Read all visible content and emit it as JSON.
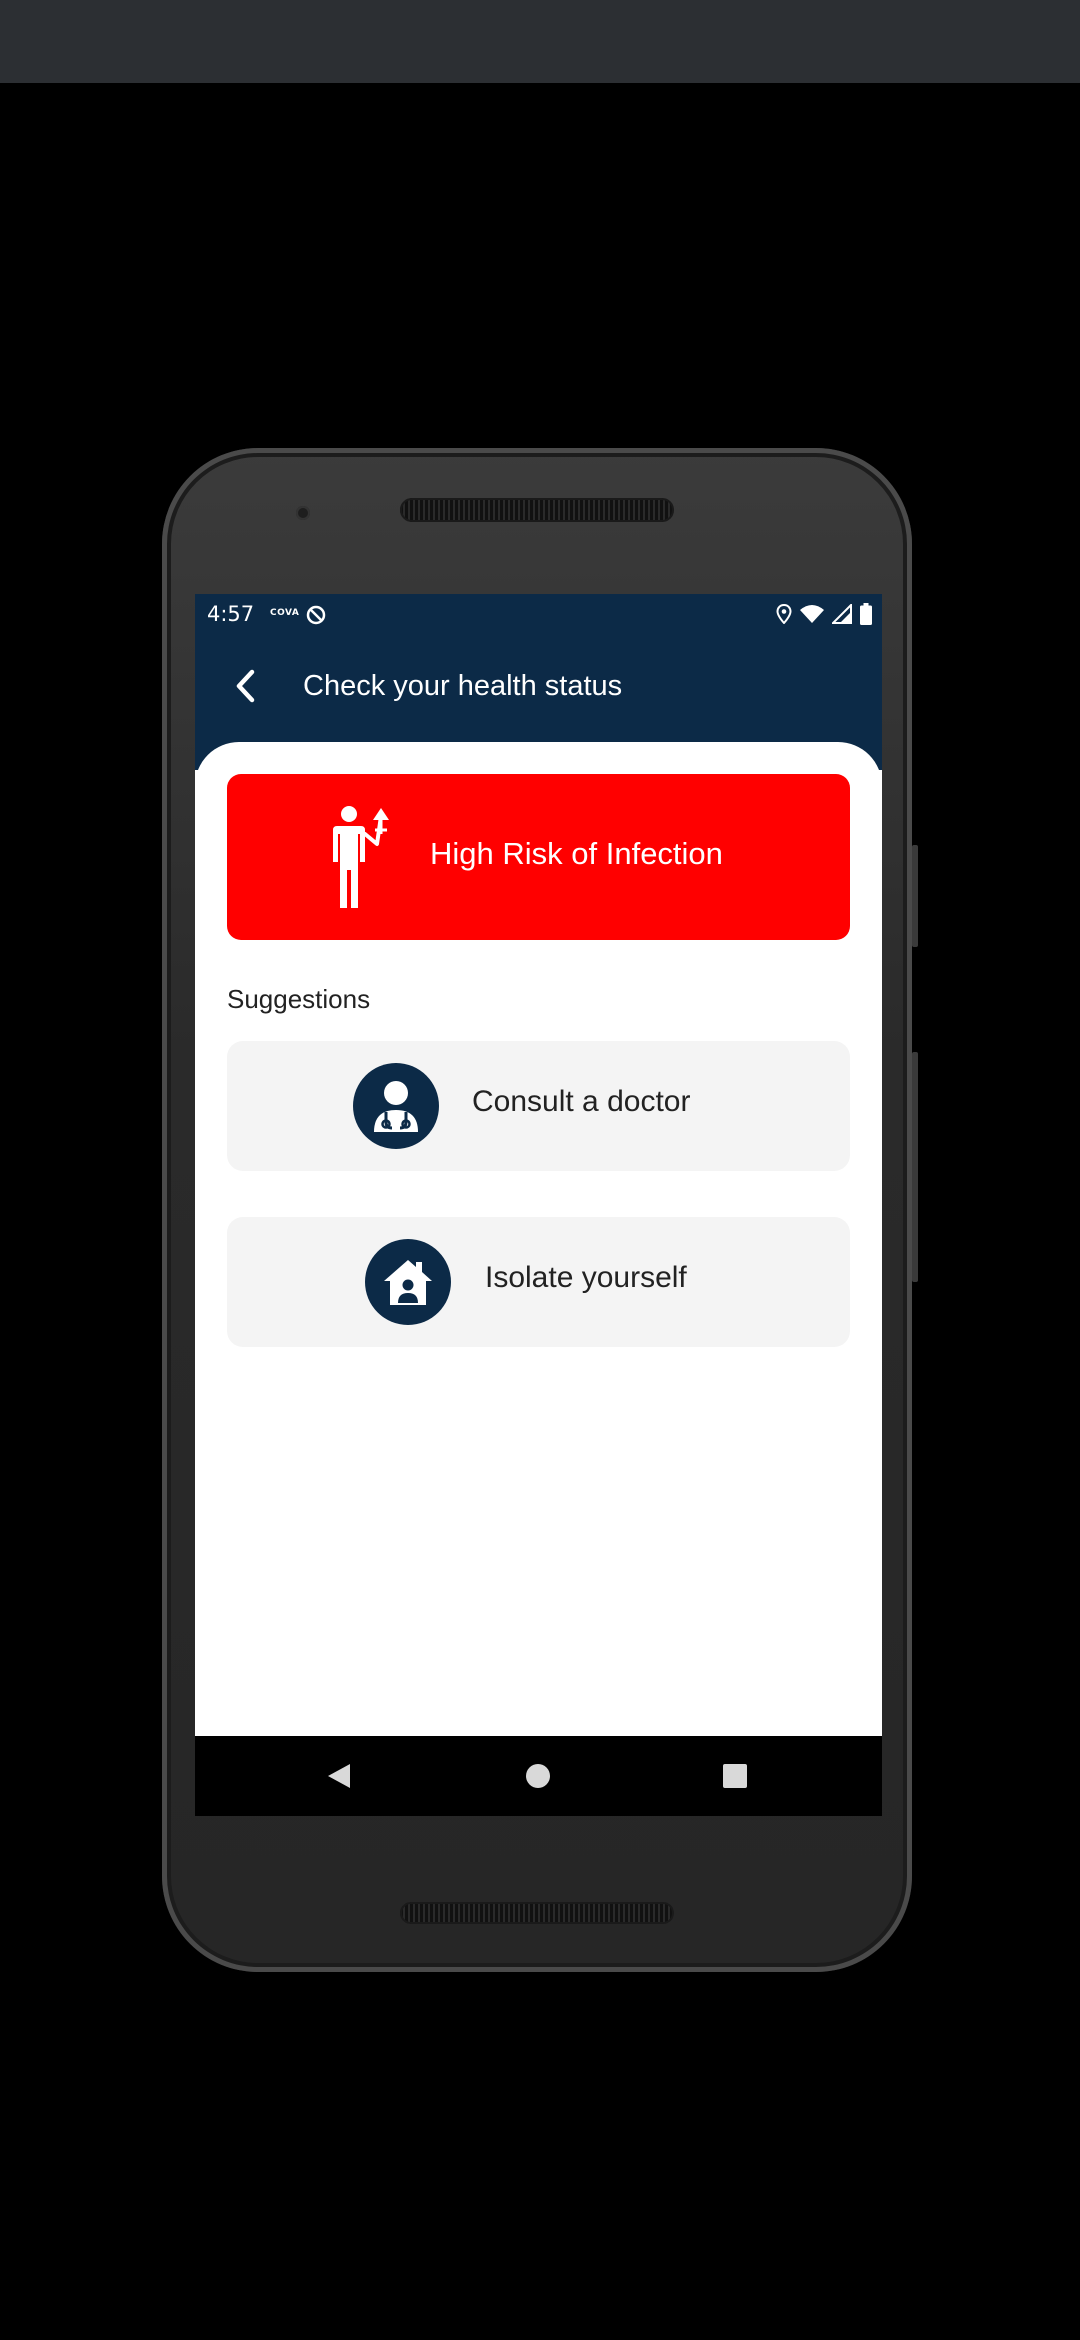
{
  "status_bar": {
    "time": "4:57",
    "carrier_badge": "COVA"
  },
  "header": {
    "title": "Check your health status"
  },
  "risk": {
    "label": "High Risk of Infection",
    "icon": "person-risk-icon",
    "color": "#ff0000"
  },
  "suggestions": {
    "heading": "Suggestions",
    "items": [
      {
        "label": "Consult a doctor",
        "icon": "doctor-icon"
      },
      {
        "label": "Isolate yourself",
        "icon": "home-isolation-icon"
      }
    ]
  },
  "colors": {
    "header_bg": "#0c2a47",
    "icon_bg": "#0c2a47",
    "card_bg": "#f4f4f4"
  }
}
